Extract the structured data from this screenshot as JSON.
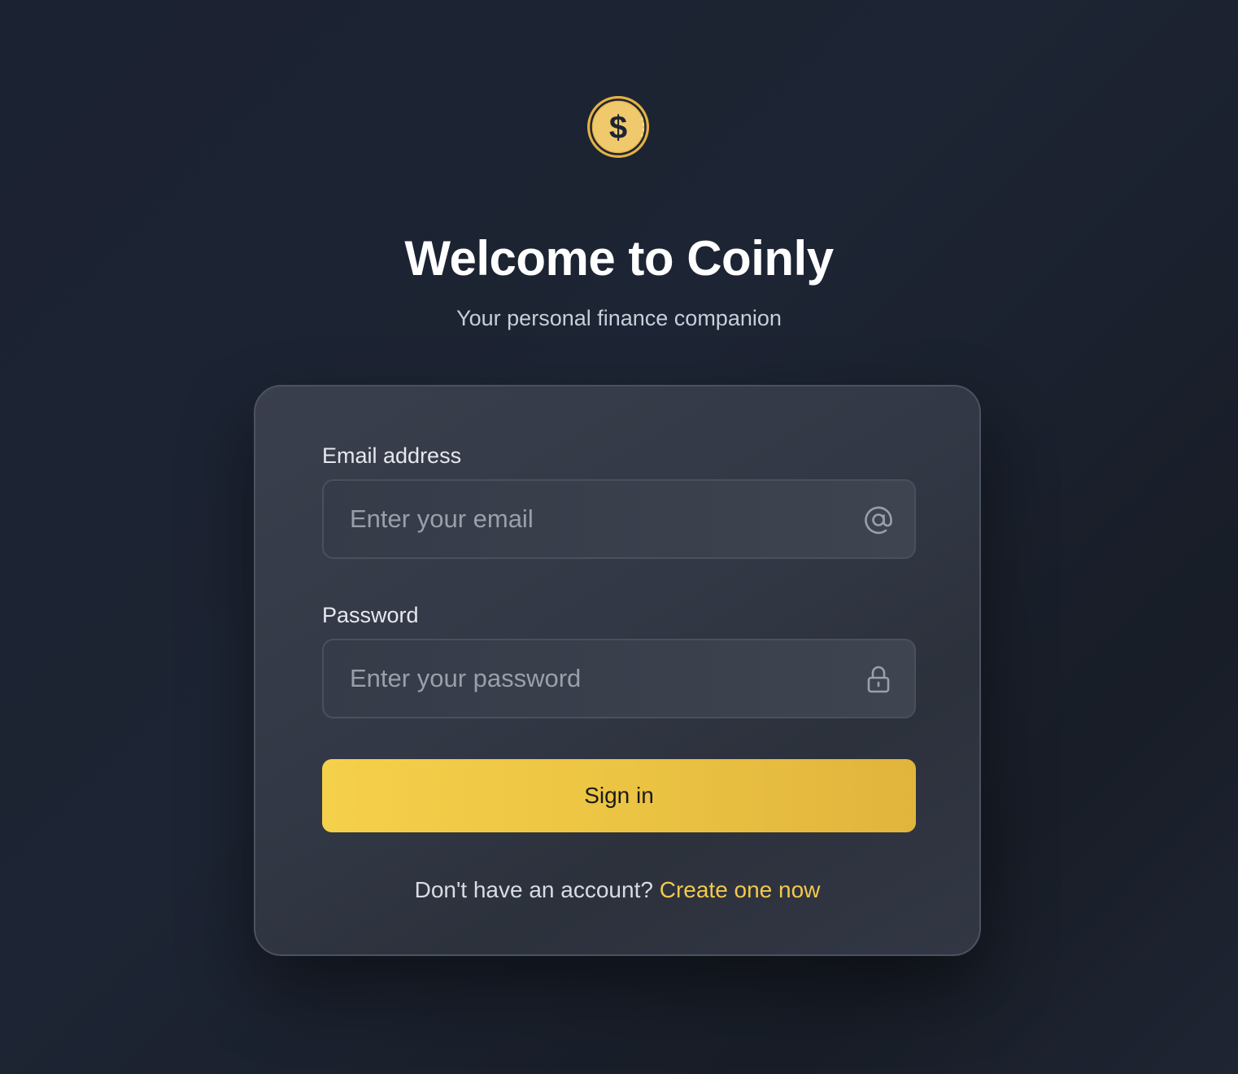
{
  "app": {
    "logo_icon": "dollar-coin-icon",
    "title": "Welcome to Coinly",
    "subtitle": "Your personal finance companion"
  },
  "form": {
    "email": {
      "label": "Email address",
      "placeholder": "Enter your email",
      "value": "",
      "icon": "at-sign-icon"
    },
    "password": {
      "label": "Password",
      "placeholder": "Enter your password",
      "value": "",
      "icon": "lock-icon"
    },
    "submit_label": "Sign in"
  },
  "footer": {
    "prompt": "Don't have an account?",
    "link_label": "Create one now"
  },
  "colors": {
    "accent": "#f2c94c",
    "background": "#1d2433",
    "card": "#343a47"
  }
}
